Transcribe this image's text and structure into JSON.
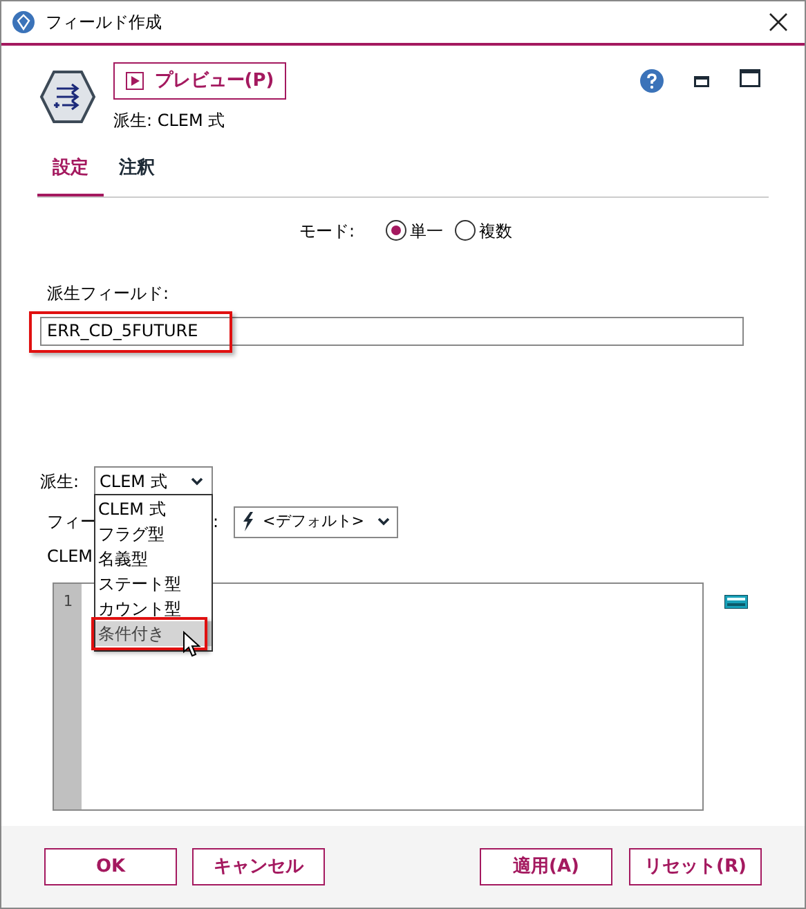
{
  "window": {
    "title": "フィールド作成"
  },
  "header": {
    "preview_button": "プレビュー(P)",
    "subtitle": "派生: CLEM 式"
  },
  "tabs": [
    {
      "label": "設定",
      "selected": true
    },
    {
      "label": "注釈",
      "selected": false
    }
  ],
  "mode": {
    "label": "モード:",
    "options": [
      {
        "label": "単一",
        "selected": true
      },
      {
        "label": "複数",
        "selected": false
      }
    ]
  },
  "derive_field": {
    "label": "派生フィールド:",
    "value": "ERR_CD_5FUTURE",
    "highlighted": true
  },
  "derive": {
    "label": "派生:",
    "value": "CLEM 式",
    "open": true,
    "options": [
      {
        "label": "CLEM 式",
        "hovered": false
      },
      {
        "label": "フラグ型",
        "hovered": false
      },
      {
        "label": "名義型",
        "hovered": false
      },
      {
        "label": "ステート型",
        "hovered": false
      },
      {
        "label": "カウント型",
        "hovered": false
      },
      {
        "label": "条件付き",
        "hovered": true
      }
    ]
  },
  "field_type": {
    "label": "フィー",
    "label_tail": ":",
    "value": "<デフォルト>"
  },
  "expression": {
    "label": "CLEM",
    "line_numbers": [
      "1"
    ]
  },
  "left_buttons": [
    {
      "label": "OK"
    },
    {
      "label": "キャンセル"
    }
  ],
  "right_buttons": [
    {
      "label": "適用(A)"
    },
    {
      "label": "リセット(R)"
    }
  ]
}
